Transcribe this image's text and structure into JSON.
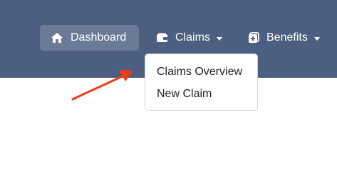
{
  "navbar": {
    "background": "#4c5f81",
    "items": [
      {
        "label": "Dashboard",
        "icon": "home-icon",
        "active": true
      },
      {
        "label": "Claims",
        "icon": "wallet-icon",
        "has_dropdown": true
      },
      {
        "label": "Benefits",
        "icon": "plus-square-icon",
        "has_dropdown": true
      }
    ]
  },
  "claims_dropdown": {
    "items": [
      {
        "label": "Claims Overview"
      },
      {
        "label": "New Claim"
      }
    ]
  },
  "annotation": {
    "arrow_color": "#f03a17"
  }
}
